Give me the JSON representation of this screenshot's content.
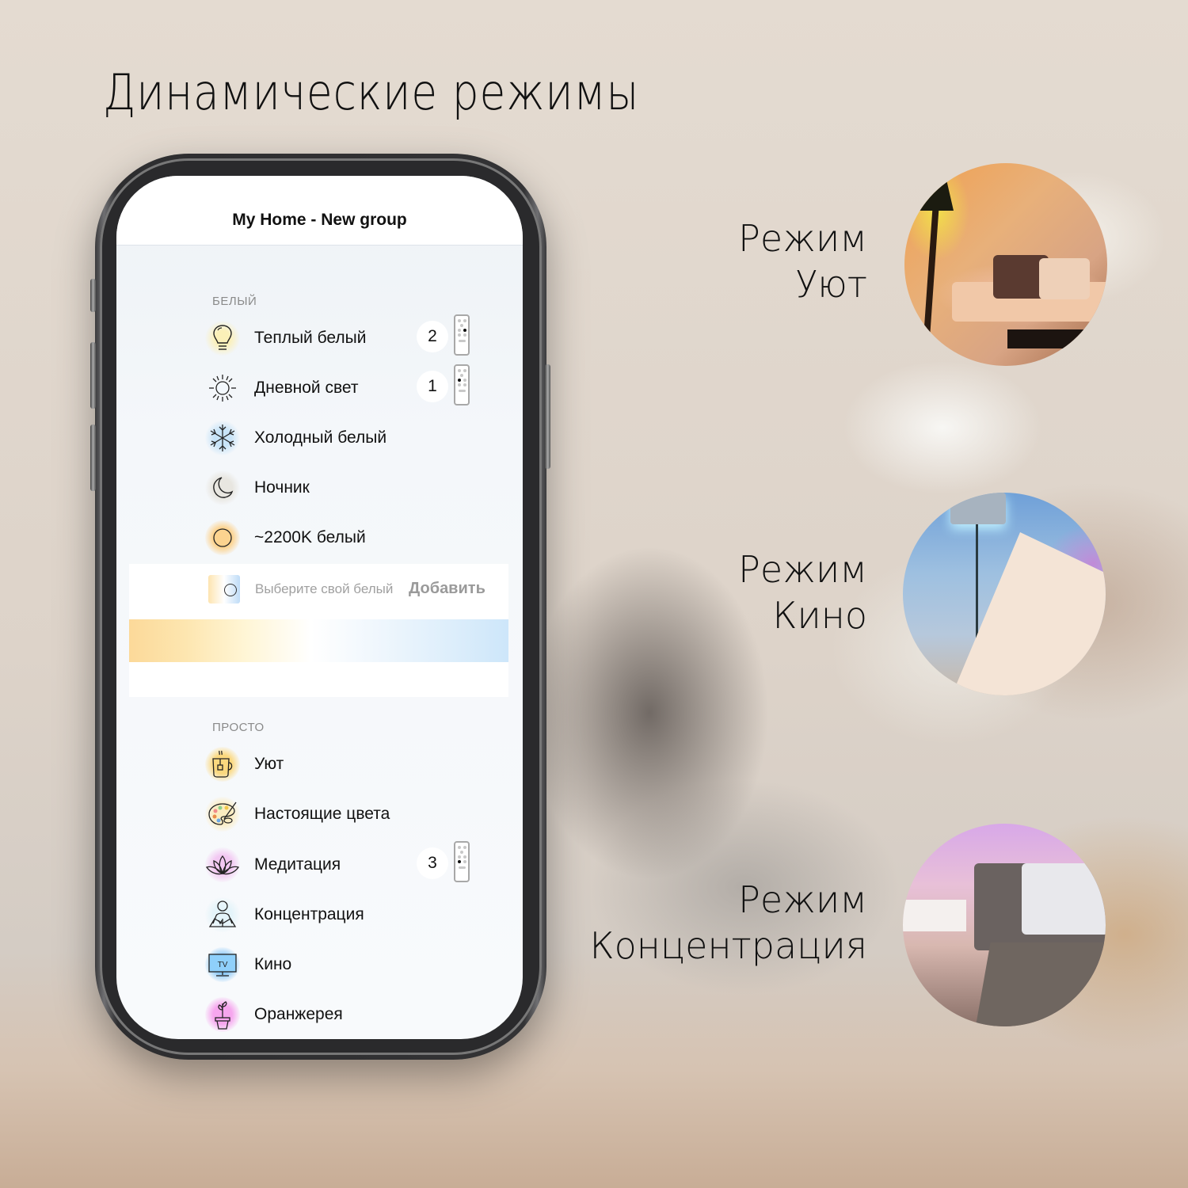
{
  "headline": "Динамические режимы",
  "app": {
    "title": "My Home - New group",
    "sections": [
      {
        "label": "БЕЛЫЙ",
        "items": [
          {
            "label": "Теплый белый",
            "icon": "lightbulb-icon",
            "badge": "2",
            "remote": true
          },
          {
            "label": "Дневной свет",
            "icon": "sun-icon",
            "badge": "1",
            "remote": true
          },
          {
            "label": "Холодный белый",
            "icon": "snowflake-icon"
          },
          {
            "label": "Ночник",
            "icon": "moon-icon"
          },
          {
            "label": "~2200K белый",
            "icon": "circle-icon"
          }
        ],
        "custom": {
          "label": "Выберите свой белый",
          "add_label": "Добавить"
        }
      },
      {
        "label": "ПРОСТО",
        "items": [
          {
            "label": "Уют",
            "icon": "tea-cup-icon"
          },
          {
            "label": "Настоящие цвета",
            "icon": "palette-icon"
          },
          {
            "label": "Медитация",
            "icon": "lotus-icon",
            "badge": "3",
            "remote": true
          },
          {
            "label": "Концентрация",
            "icon": "reading-person-icon"
          },
          {
            "label": "Кино",
            "icon": "tv-icon",
            "tv_text": "TV"
          },
          {
            "label": "Оранжерея",
            "icon": "plant-pot-icon"
          }
        ]
      }
    ]
  },
  "modes": [
    {
      "line1": "Режим",
      "line2": "Уют",
      "photo": "cozy-living-room-photo"
    },
    {
      "line1": "Режим",
      "line2": "Кино",
      "photo": "kids-tent-room-photo"
    },
    {
      "line1": "Режим",
      "line2": "Концентрация",
      "photo": "bedroom-photo"
    }
  ],
  "colors": {
    "warm_glow": "#fbe9a8",
    "cold_glow": "#bfe0f7",
    "tv_blue": "#7cc2f7",
    "pink_glow": "#f6a6ee",
    "lotus_glow": "#f2c8f2"
  }
}
